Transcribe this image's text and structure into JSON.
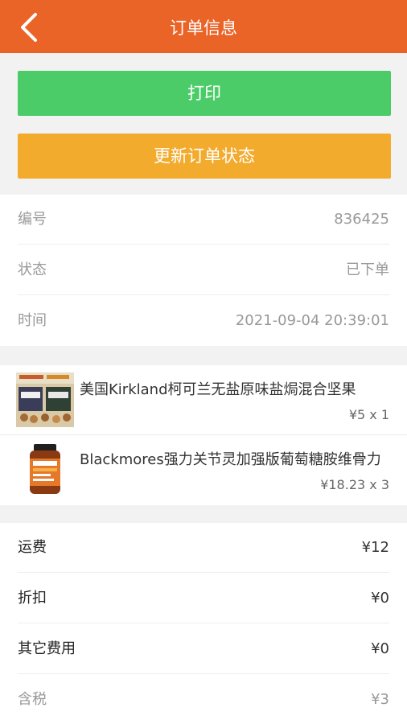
{
  "header": {
    "title": "订单信息",
    "back_icon": "chevron-left-icon"
  },
  "actions": {
    "print_label": "打印",
    "update_status_label": "更新订单状态"
  },
  "info": {
    "rows": [
      {
        "label": "编号",
        "value": "836425"
      },
      {
        "label": "状态",
        "value": "已下单"
      },
      {
        "label": "时间",
        "value": "2021-09-04 20:39:01"
      }
    ]
  },
  "items": [
    {
      "name": "美国Kirkland柯可兰无盐原味盐焗混合坚果",
      "price": "¥5 x 1"
    },
    {
      "name": "Blackmores强力关节灵加强版葡萄糖胺维骨力",
      "price": "¥18.23 x 3"
    }
  ],
  "fees": {
    "rows": [
      {
        "label": "运费",
        "value": "¥12"
      },
      {
        "label": "折扣",
        "value": "¥0"
      },
      {
        "label": "其它费用",
        "value": "¥0"
      },
      {
        "label": "含税",
        "value": "¥3"
      }
    ]
  },
  "colors": {
    "header": "#ea6327",
    "print": "#4ccc69",
    "update": "#f3ab2e"
  }
}
